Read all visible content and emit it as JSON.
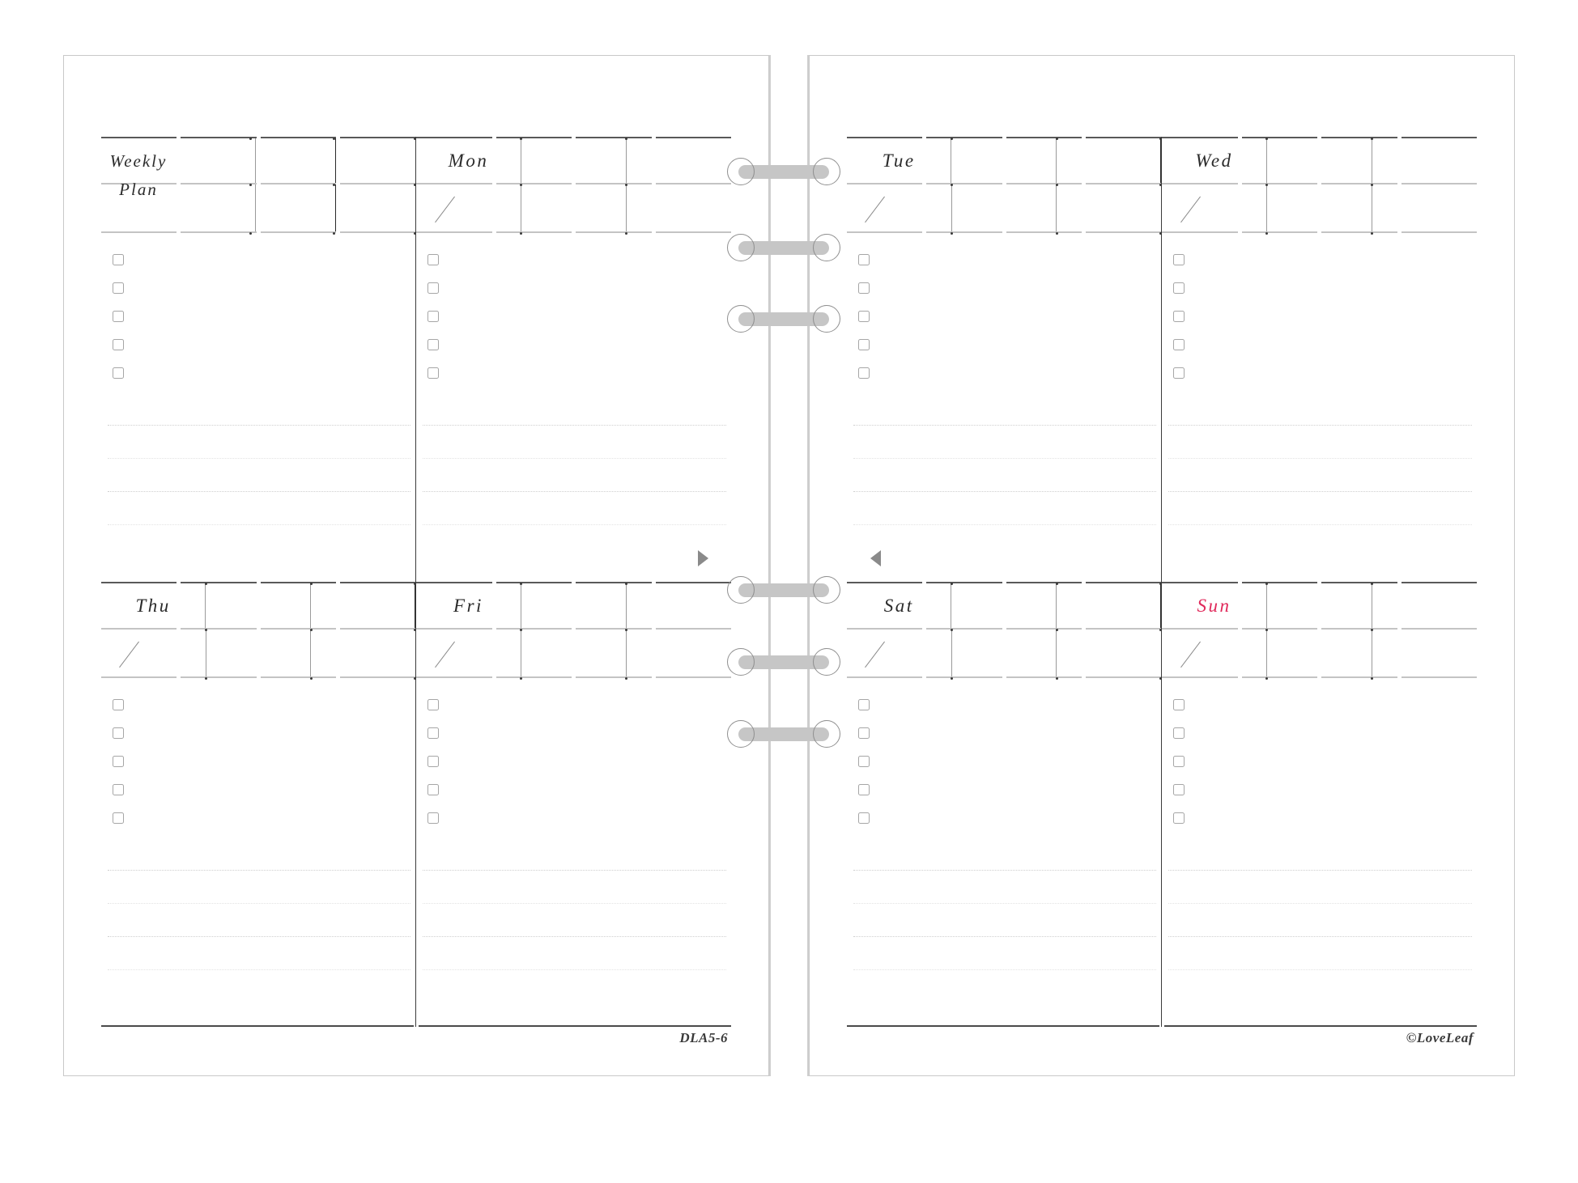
{
  "document": {
    "kind": "weekly-planner-spread",
    "product_code": "DLA5-6",
    "copyright": "©LoveLeaf",
    "colors": {
      "ink": "#2b2b2b",
      "rule_dark": "#595959",
      "rule_light": "#c4c4c4",
      "sunday_accent": "#e0285a",
      "ring_gray": "#c6c6c6",
      "sheet_border": "#c9c9c9"
    }
  },
  "left_page": {
    "quadrants": [
      {
        "id": "weekly-plan",
        "title_line1": "Weekly",
        "title_line2": "Plan",
        "day_label": "",
        "date_slash": "",
        "checkbox_count": 5,
        "note_line_count": 4
      },
      {
        "id": "mon",
        "day_label": "Mon",
        "date_slash": "/",
        "checkbox_count": 5,
        "note_line_count": 4
      },
      {
        "id": "thu",
        "day_label": "Thu",
        "date_slash": "/",
        "checkbox_count": 5,
        "note_line_count": 4
      },
      {
        "id": "fri",
        "day_label": "Fri",
        "date_slash": "/",
        "checkbox_count": 5,
        "note_line_count": 4
      }
    ],
    "footer": "DLA5-6"
  },
  "right_page": {
    "quadrants": [
      {
        "id": "tue",
        "day_label": "Tue",
        "date_slash": "/",
        "checkbox_count": 5,
        "note_line_count": 4
      },
      {
        "id": "wed",
        "day_label": "Wed",
        "date_slash": "/",
        "checkbox_count": 5,
        "note_line_count": 4
      },
      {
        "id": "sat",
        "day_label": "Sat",
        "date_slash": "/",
        "checkbox_count": 5,
        "note_line_count": 4
      },
      {
        "id": "sun",
        "day_label": "Sun",
        "date_slash": "/",
        "is_weekend_accent": true,
        "checkbox_count": 5,
        "note_line_count": 4
      }
    ],
    "footer": "©LoveLeaf"
  },
  "binder": {
    "ring_count": 6,
    "ring_positions_y": [
      195,
      289,
      377,
      712,
      801,
      890
    ]
  },
  "navigation": {
    "next_page_arrow": "triangle-right",
    "prev_page_arrow": "triangle-left"
  }
}
